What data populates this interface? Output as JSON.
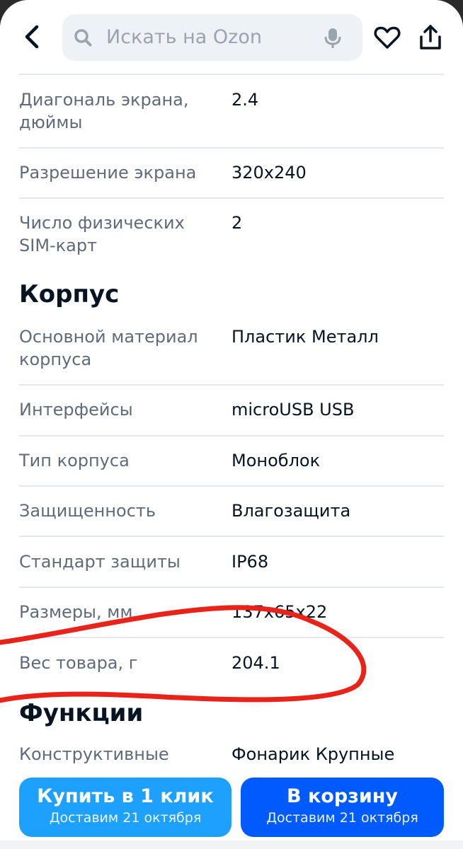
{
  "header": {
    "search_placeholder": "Искать на Ozon"
  },
  "specs_top": [
    {
      "key_lines": [
        "Диагональ экрана,",
        "дюймы"
      ],
      "value": "2.4"
    },
    {
      "key_lines": [
        "Разрешение экрана"
      ],
      "value": "320x240"
    },
    {
      "key_lines": [
        "Число физических",
        "SIM-карт"
      ],
      "value": "2"
    }
  ],
  "sections": {
    "body_title": "Корпус",
    "functions_title": "Функции"
  },
  "specs_body": [
    {
      "key_lines": [
        "Основной материал",
        "корпуса"
      ],
      "value": "Пластик Металл"
    },
    {
      "key_lines": [
        "Интерфейсы"
      ],
      "value": "microUSB USB"
    },
    {
      "key_lines": [
        "Тип корпуса"
      ],
      "value": "Моноблок"
    },
    {
      "key_lines": [
        "Защищенность"
      ],
      "value": "Влагозащита"
    },
    {
      "key_lines": [
        "Стандарт защиты"
      ],
      "value": "IP68"
    },
    {
      "key_lines": [
        "Размеры, мм"
      ],
      "value": "137x65x22"
    },
    {
      "key_lines": [
        "Вес товара, г"
      ],
      "value": "204.1"
    }
  ],
  "specs_functions": [
    {
      "key_lines": [
        "Конструктивные"
      ],
      "value": "Фонарик Крупные"
    }
  ],
  "buttons": {
    "quick_buy": {
      "title": "Купить в 1 клик",
      "subtitle": "Доставим 21 октября"
    },
    "add_to_cart": {
      "title": "В корзину",
      "subtitle": "Доставим 21 октября"
    }
  },
  "colors": {
    "quick_buy_bg": "#1ea0ff",
    "cart_bg": "#005bff",
    "annotation": "#e8241a"
  },
  "icons": [
    "back-arrow-icon",
    "search-icon",
    "microphone-icon",
    "heart-icon",
    "share-icon"
  ]
}
